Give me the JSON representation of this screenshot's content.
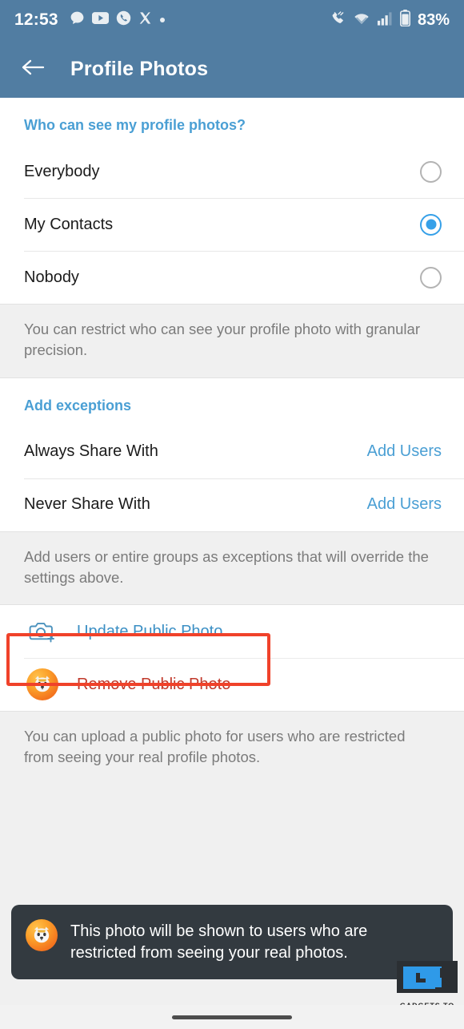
{
  "statusbar": {
    "time": "12:53",
    "battery_percent": "83%",
    "left_icons": [
      "chat-bubble-icon",
      "youtube-icon",
      "phone-circle-icon",
      "x-twitter-icon",
      "dot-icon"
    ],
    "right_icons": [
      "call-mute-icon",
      "wifi-icon",
      "cellular-signal-icon",
      "battery-icon"
    ]
  },
  "appbar": {
    "back_icon": "arrow-left-icon",
    "title": "Profile Photos"
  },
  "visibility_section": {
    "header": "Who can see my profile photos?",
    "options": [
      {
        "label": "Everybody",
        "selected": false
      },
      {
        "label": "My Contacts",
        "selected": true
      },
      {
        "label": "Nobody",
        "selected": false
      }
    ],
    "note": "You can restrict who can see your profile photo with granular precision."
  },
  "exceptions_section": {
    "header": "Add exceptions",
    "rows": [
      {
        "label": "Always Share With",
        "action": "Add Users"
      },
      {
        "label": "Never Share With",
        "action": "Add Users"
      }
    ],
    "note": "Add users or entire groups as exceptions that will override the settings above."
  },
  "public_photo_section": {
    "rows": [
      {
        "label": "Update Public Photo",
        "icon": "camera-plus-icon",
        "style": "update"
      },
      {
        "label": "Remove Public Photo",
        "icon": "avatar-thumbnail",
        "style": "remove"
      }
    ],
    "note": "You can upload a public photo for users who are restricted from seeing your real profile photos.",
    "highlight_color": "#f0422a"
  },
  "toast": {
    "icon": "avatar-thumbnail",
    "message": "This photo will be shown to users who are restricted from seeing your real photos."
  },
  "watermark": {
    "caption": "GADGETS TO USE"
  },
  "colors": {
    "header_blue": "#517da2",
    "accent_blue": "#4a9fd4",
    "radio_selected": "#36a0e8",
    "remove_red": "#c0392b",
    "note_bg": "#f0f0f0",
    "toast_bg": "#333a40"
  }
}
